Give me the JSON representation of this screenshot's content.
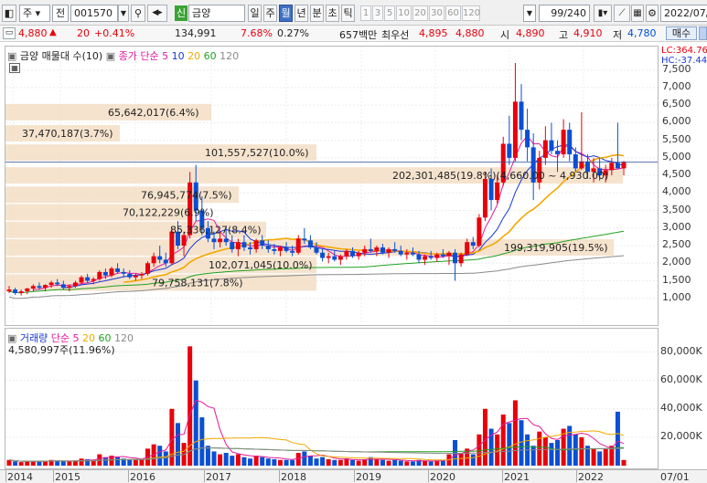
{
  "toolbar": {
    "market": "주",
    "type": "전",
    "code": "001570",
    "credit_badge": "신",
    "name": "금양",
    "periods": [
      "일",
      "주",
      "월",
      "년",
      "분",
      "초",
      "틱"
    ],
    "active_period": "월",
    "numbers": [
      "1",
      "3",
      "5",
      "10",
      "20",
      "30",
      "60",
      "120"
    ],
    "count": "99",
    "count_total": "/240",
    "date": "2022/07/"
  },
  "quote": {
    "price": "4,880",
    "change_arrow": "▲",
    "change": "20",
    "change_pct": "+0.41%",
    "volume": "134,991",
    "turnover_pct": "7.68%",
    "vol_ratio": "0.27%",
    "amount": "657백만",
    "best_ask_label": "최우선",
    "best_ask": "4,895",
    "best_bid": "4,880",
    "open_label": "시",
    "open": "4,890",
    "high_label": "고",
    "high": "4,910",
    "low_label": "저",
    "low": "4,780",
    "order_button": "매수"
  },
  "price_panel": {
    "legend_title": "금양 매물대 수(10)",
    "legend_ma_label": "종가 단순",
    "ma_periods": [
      "5",
      "10",
      "20",
      "60",
      "120"
    ],
    "ma_colors": [
      "#e5199b",
      "#1736d6",
      "#f2a900",
      "#21a121",
      "#8a8a8a"
    ],
    "lc_label": "LC:364.76",
    "hc_label": "HC:-37.44",
    "volume_profile": [
      {
        "label": "79,758,131(7.8%)",
        "level": 1450
      },
      {
        "label": "102,071,045(10.0%)",
        "level": 1950
      },
      {
        "label": "199,319,905(19.5%)",
        "level": 2450
      },
      {
        "label": "85,336,127(8.4%)",
        "level": 2950
      },
      {
        "label": "70,122,229(6.9%)",
        "level": 3450
      },
      {
        "label": "76,945,774(7.5%)",
        "level": 3950
      },
      {
        "label": "202,301,485(19.8%)(4,660.00 ~ 4,930.00)",
        "level": 4500
      },
      {
        "label": "101,557,527(10.0%)",
        "level": 5150
      },
      {
        "label": "37,470,187(3.7%)",
        "level": 5700
      },
      {
        "label": "65,642,017(6.4%)",
        "level": 6300
      }
    ]
  },
  "volume_panel": {
    "legend_title": "거래량",
    "legend_ma_label": "단순",
    "ma_periods": [
      "5",
      "20",
      "60",
      "120"
    ],
    "max_label": "4,580,997주(11.96%)"
  },
  "axis": {
    "price_ticks": [
      "7,500",
      "7,000",
      "6,500",
      "6,000",
      "5,500",
      "5,000",
      "4,500",
      "4,000",
      "3,500",
      "3,000",
      "2,500",
      "2,000",
      "1,500",
      "1,000"
    ],
    "volume_ticks": [
      "80,000K",
      "60,000K",
      "40,000K",
      "20,000K"
    ],
    "years": [
      "2014",
      "2015",
      "2016",
      "2017",
      "2018",
      "2019",
      "2020",
      "2021",
      "2022"
    ],
    "last_label": "07/01"
  },
  "chart_data": {
    "type": "candlestick",
    "x": "monthly 2014-01 .. 2022-07",
    "ylim": [
      500,
      7700
    ],
    "volume_ylim_k": [
      0,
      90000
    ],
    "candles": [
      [
        1200,
        1350,
        1150,
        1250,
        4000
      ],
      [
        1250,
        1300,
        1100,
        1150,
        3000
      ],
      [
        1150,
        1250,
        1080,
        1200,
        2500
      ],
      [
        1200,
        1300,
        1120,
        1280,
        3000
      ],
      [
        1280,
        1400,
        1200,
        1350,
        3500
      ],
      [
        1350,
        1450,
        1250,
        1300,
        3000
      ],
      [
        1300,
        1400,
        1200,
        1380,
        3000
      ],
      [
        1380,
        1500,
        1300,
        1450,
        4000
      ],
      [
        1450,
        1550,
        1350,
        1400,
        3500
      ],
      [
        1400,
        1500,
        1250,
        1300,
        3000
      ],
      [
        1300,
        1400,
        1200,
        1350,
        3000
      ],
      [
        1350,
        1500,
        1300,
        1450,
        3500
      ],
      [
        1450,
        1650,
        1400,
        1600,
        5000
      ],
      [
        1600,
        1700,
        1450,
        1500,
        4500
      ],
      [
        1500,
        1600,
        1400,
        1550,
        4000
      ],
      [
        1550,
        1800,
        1500,
        1750,
        8000
      ],
      [
        1750,
        1850,
        1550,
        1650,
        6000
      ],
      [
        1650,
        1900,
        1600,
        1850,
        7000
      ],
      [
        1850,
        2000,
        1700,
        1750,
        6000
      ],
      [
        1750,
        1850,
        1600,
        1700,
        5000
      ],
      [
        1700,
        1800,
        1550,
        1600,
        4500
      ],
      [
        1600,
        1700,
        1500,
        1650,
        4000
      ],
      [
        1650,
        1750,
        1550,
        1700,
        4000
      ],
      [
        1700,
        2050,
        1650,
        2000,
        12000
      ],
      [
        2000,
        2300,
        1900,
        2200,
        15000
      ],
      [
        2200,
        2500,
        2000,
        2100,
        14000
      ],
      [
        2100,
        2300,
        1900,
        2000,
        10000
      ],
      [
        2000,
        3000,
        1950,
        2900,
        40000
      ],
      [
        2900,
        3200,
        2400,
        2500,
        30000
      ],
      [
        2500,
        2900,
        2200,
        2800,
        16000
      ],
      [
        2800,
        4600,
        2700,
        4300,
        84000
      ],
      [
        4300,
        4800,
        3200,
        3500,
        60000
      ],
      [
        3500,
        3900,
        2800,
        3000,
        34000
      ],
      [
        3000,
        3200,
        2600,
        2700,
        14000
      ],
      [
        2700,
        2900,
        2400,
        2600,
        10000
      ],
      [
        2600,
        2900,
        2450,
        2700,
        8000
      ],
      [
        2700,
        3000,
        2500,
        2600,
        9000
      ],
      [
        2600,
        2800,
        2300,
        2400,
        7000
      ],
      [
        2400,
        2700,
        2200,
        2600,
        8000
      ],
      [
        2600,
        2800,
        2350,
        2450,
        6000
      ],
      [
        2450,
        2600,
        2250,
        2400,
        5000
      ],
      [
        2400,
        2700,
        2300,
        2650,
        7000
      ],
      [
        2650,
        2800,
        2400,
        2500,
        6000
      ],
      [
        2500,
        2650,
        2300,
        2400,
        5000
      ],
      [
        2400,
        2550,
        2250,
        2350,
        4500
      ],
      [
        2350,
        2500,
        2200,
        2450,
        4000
      ],
      [
        2450,
        2600,
        2300,
        2350,
        4000
      ],
      [
        2350,
        2500,
        2200,
        2300,
        4000
      ],
      [
        2300,
        2800,
        2250,
        2700,
        9000
      ],
      [
        2700,
        3000,
        2550,
        2650,
        10000
      ],
      [
        2650,
        2800,
        2400,
        2450,
        7000
      ],
      [
        2450,
        2600,
        2250,
        2300,
        5000
      ],
      [
        2300,
        2400,
        2050,
        2150,
        6000
      ],
      [
        2150,
        2300,
        2000,
        2200,
        4500
      ],
      [
        2200,
        2350,
        2050,
        2100,
        4000
      ],
      [
        2100,
        2250,
        1950,
        2200,
        4000
      ],
      [
        2200,
        2400,
        2100,
        2350,
        5000
      ],
      [
        2350,
        2450,
        2150,
        2200,
        4000
      ],
      [
        2200,
        2350,
        2100,
        2300,
        3500
      ],
      [
        2300,
        2500,
        2200,
        2400,
        4500
      ],
      [
        2400,
        2700,
        2300,
        2350,
        6000
      ],
      [
        2350,
        2500,
        2200,
        2450,
        4500
      ],
      [
        2450,
        2550,
        2250,
        2300,
        4000
      ],
      [
        2300,
        2450,
        2150,
        2400,
        3500
      ],
      [
        2400,
        2600,
        2300,
        2350,
        4000
      ],
      [
        2350,
        2500,
        2200,
        2250,
        3500
      ],
      [
        2250,
        2400,
        2100,
        2300,
        3000
      ],
      [
        2300,
        2450,
        2200,
        2250,
        3000
      ],
      [
        2250,
        2350,
        2000,
        2100,
        4000
      ],
      [
        2100,
        2250,
        1950,
        2200,
        3500
      ],
      [
        2200,
        2350,
        2100,
        2150,
        3000
      ],
      [
        2150,
        2300,
        2050,
        2250,
        3500
      ],
      [
        2250,
        2400,
        2150,
        2200,
        4000
      ],
      [
        2200,
        2350,
        1950,
        2300,
        8000
      ],
      [
        2300,
        2400,
        1500,
        2000,
        18000
      ],
      [
        2000,
        2300,
        1900,
        2250,
        9000
      ],
      [
        2250,
        2700,
        2200,
        2600,
        12000
      ],
      [
        2600,
        2750,
        2400,
        2500,
        8000
      ],
      [
        2500,
        3400,
        2450,
        3300,
        22000
      ],
      [
        3300,
        4600,
        3200,
        4400,
        40000
      ],
      [
        4400,
        4700,
        3500,
        3800,
        26000
      ],
      [
        3800,
        4500,
        3700,
        4300,
        22000
      ],
      [
        4300,
        5600,
        4200,
        5400,
        36000
      ],
      [
        5400,
        6200,
        4800,
        5000,
        30000
      ],
      [
        5000,
        7700,
        4900,
        6600,
        46000
      ],
      [
        6600,
        7100,
        5500,
        5800,
        32000
      ],
      [
        5800,
        6400,
        4900,
        5300,
        22000
      ],
      [
        5300,
        5700,
        3800,
        4300,
        14000
      ],
      [
        4300,
        5200,
        4100,
        5000,
        24000
      ],
      [
        5000,
        5900,
        4800,
        5500,
        20000
      ],
      [
        5500,
        6000,
        5100,
        5200,
        16000
      ],
      [
        5200,
        5500,
        4600,
        5100,
        18000
      ],
      [
        5100,
        6100,
        5000,
        5800,
        26000
      ],
      [
        5800,
        6000,
        4900,
        5100,
        28000
      ],
      [
        5100,
        5300,
        4600,
        4700,
        22000
      ],
      [
        4700,
        6300,
        4650,
        4900,
        20000
      ],
      [
        4900,
        5100,
        4400,
        4600,
        14000
      ],
      [
        4600,
        5000,
        4300,
        4700,
        12000
      ],
      [
        4700,
        5000,
        4350,
        4500,
        10000
      ],
      [
        4500,
        4800,
        4300,
        4650,
        12000
      ],
      [
        4650,
        5000,
        4500,
        4860,
        14000
      ],
      [
        4860,
        6000,
        4700,
        4700,
        38000
      ],
      [
        4700,
        4910,
        4500,
        4880,
        4000
      ]
    ]
  }
}
